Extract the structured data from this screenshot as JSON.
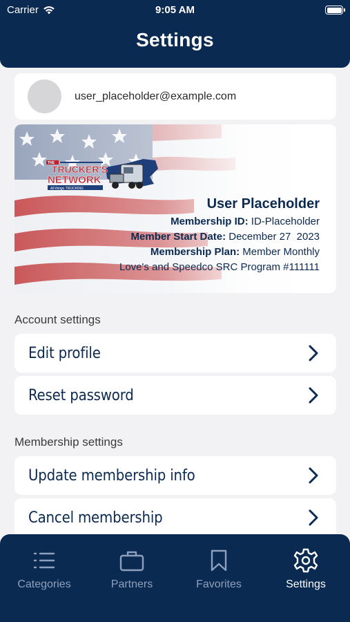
{
  "status_bar": {
    "carrier": "Carrier",
    "time": "9:05 AM",
    "battery_level": 1.0
  },
  "header": {
    "title": "Settings"
  },
  "user": {
    "email": "user_placeholder@example.com"
  },
  "membership_card": {
    "logo_text": "THE TRUCKER'S NETWORK",
    "logo_tagline": "All things TRUCKING",
    "name": "User Placeholder",
    "id_label": "Membership ID:",
    "id_value": "ID-Placeholder",
    "start_label": "Member Start Date:",
    "start_value": "December 27  2023",
    "plan_label": "Membership Plan:",
    "plan_value": "Member Monthly",
    "program": "Love's and Speedco SRC Program #111111"
  },
  "account_settings": {
    "label": "Account settings",
    "items": [
      {
        "label": "Edit profile"
      },
      {
        "label": "Reset password"
      }
    ]
  },
  "membership_settings": {
    "label": "Membership settings",
    "items": [
      {
        "label": "Update membership info"
      },
      {
        "label": "Cancel membership"
      }
    ]
  },
  "tabbar": {
    "tabs": [
      {
        "label": "Categories",
        "icon": "list-icon"
      },
      {
        "label": "Partners",
        "icon": "briefcase-icon"
      },
      {
        "label": "Favorites",
        "icon": "bookmark-icon"
      },
      {
        "label": "Settings",
        "icon": "gear-icon",
        "active": true
      }
    ]
  },
  "colors": {
    "navy": "#0b2a52",
    "inactive_tab": "#8ea0bb",
    "background": "#f2f2f4"
  }
}
